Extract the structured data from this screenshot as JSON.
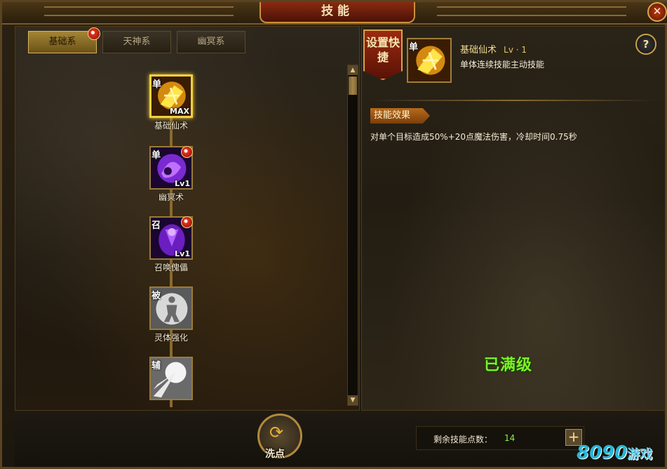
{
  "window": {
    "title": "技能",
    "close_label": "✕"
  },
  "tabs": [
    {
      "label": "基础系",
      "active": true,
      "has_badge": true
    },
    {
      "label": "天神系",
      "active": false,
      "has_badge": false
    },
    {
      "label": "幽冥系",
      "active": false,
      "has_badge": false
    }
  ],
  "skills": [
    {
      "name": "基础仙术",
      "type": "单",
      "level": "MAX",
      "badge": false,
      "selected": true,
      "theme": "gold"
    },
    {
      "name": "幽冥术",
      "type": "单",
      "level": "Lv1",
      "badge": true,
      "selected": false,
      "theme": "purple"
    },
    {
      "name": "召唤傀儡",
      "type": "召",
      "level": "Lv1",
      "badge": true,
      "selected": false,
      "theme": "purple"
    },
    {
      "name": "灵体强化",
      "type": "被",
      "level": "",
      "badge": false,
      "selected": false,
      "theme": "silver"
    },
    {
      "name": "",
      "type": "辅",
      "level": "",
      "badge": false,
      "selected": false,
      "theme": "white"
    }
  ],
  "scrollbar": {
    "up": "▲",
    "down": "▼"
  },
  "detail": {
    "shortcut_label": "设置快捷",
    "icon_type": "单",
    "skill_name": "基础仙术",
    "skill_level": "Lv · 1",
    "description": "单体连续技能主动技能",
    "help_label": "?",
    "effect_title": "技能效果",
    "effect_text": "对单个目标造成50%+20点魔法伤害，冷却时间0.75秒",
    "status": "已满级"
  },
  "footer": {
    "reset_label": "洗点",
    "points_label": "剩余技能点数：",
    "points_value": "14",
    "add_label": "+"
  },
  "watermark": {
    "number": "8090",
    "text": "游戏"
  },
  "colors": {
    "accent_gold": "#f2d040",
    "maxed_green": "#7cf02a",
    "points_green": "#8ef040"
  }
}
